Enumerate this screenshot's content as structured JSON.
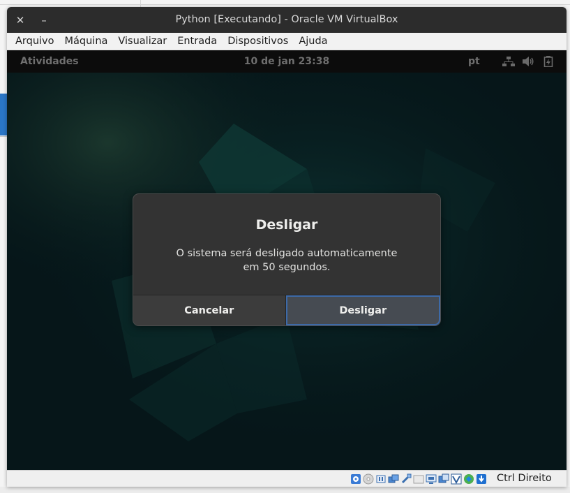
{
  "window": {
    "title": "Python [Executando] - Oracle VM VirtualBox",
    "close_glyph": "✕",
    "minimize_glyph": "–"
  },
  "menu": {
    "items": [
      {
        "label": "Arquivo"
      },
      {
        "label": "Máquina"
      },
      {
        "label": "Visualizar"
      },
      {
        "label": "Entrada"
      },
      {
        "label": "Dispositivos"
      },
      {
        "label": "Ajuda"
      }
    ]
  },
  "guest_panel": {
    "activities": "Atividades",
    "clock": "10 de jan  23:38",
    "language": "pt",
    "icons": [
      "network-icon",
      "volume-icon",
      "battery-icon"
    ]
  },
  "dialog": {
    "title": "Desligar",
    "message": "O sistema será desligado automaticamente em 50 segundos.",
    "cancel_label": "Cancelar",
    "confirm_label": "Desligar"
  },
  "statusbar": {
    "icons": [
      "hard-disk-icon",
      "optical-drive-icon",
      "audio-icon",
      "network-adapter-icon",
      "usb-icon",
      "shared-folders-icon",
      "display-icon",
      "recording-icon",
      "virtualization-icon",
      "mouse-integration-icon",
      "keyboard-capture-icon"
    ],
    "host_key": "Ctrl Direito"
  },
  "colors": {
    "titlebar": "#2c2c2c",
    "guest_background": "#071b1d",
    "dialog_background": "#333333",
    "focus_accent": "#3d6aa8"
  }
}
